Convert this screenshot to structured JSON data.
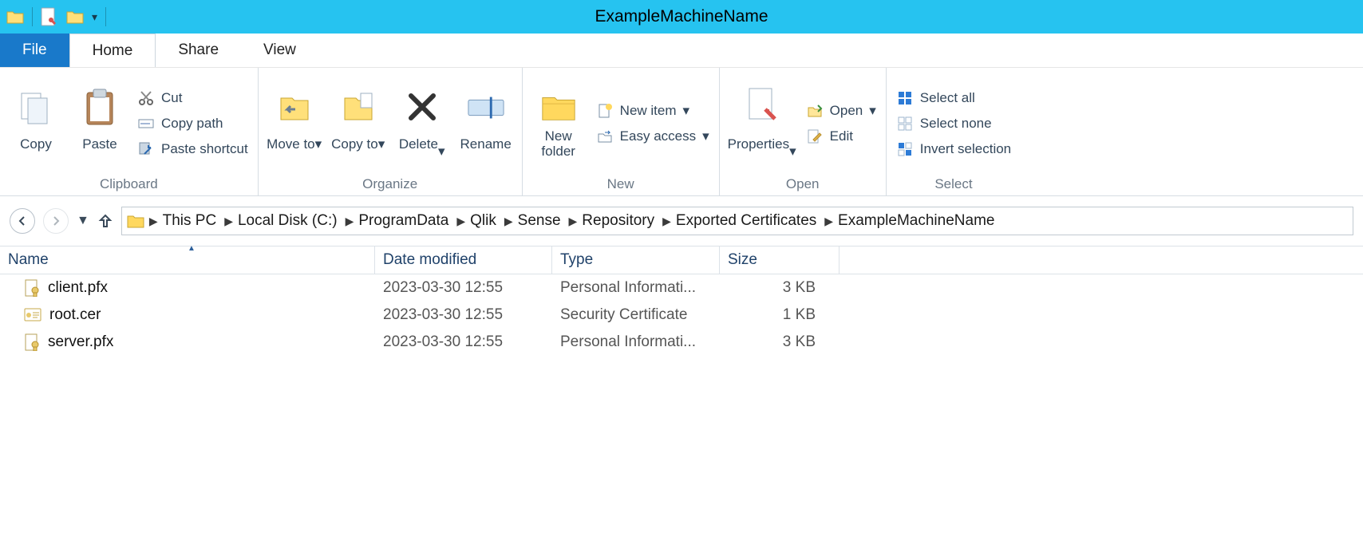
{
  "window": {
    "title": "ExampleMachineName"
  },
  "menubar": {
    "file": "File",
    "home": "Home",
    "share": "Share",
    "view": "View"
  },
  "ribbon": {
    "clipboard": {
      "label": "Clipboard",
      "copy": "Copy",
      "paste": "Paste",
      "cut": "Cut",
      "copy_path": "Copy path",
      "paste_shortcut": "Paste shortcut"
    },
    "organize": {
      "label": "Organize",
      "move_to": "Move to",
      "copy_to": "Copy to",
      "delete": "Delete",
      "rename": "Rename"
    },
    "new": {
      "label": "New",
      "new_folder": "New folder",
      "new_item": "New item",
      "easy_access": "Easy access"
    },
    "open": {
      "label": "Open",
      "properties": "Properties",
      "open": "Open",
      "edit": "Edit"
    },
    "select": {
      "label": "Select",
      "select_all": "Select all",
      "select_none": "Select none",
      "invert": "Invert selection"
    }
  },
  "breadcrumb": {
    "items": [
      "This PC",
      "Local Disk (C:)",
      "ProgramData",
      "Qlik",
      "Sense",
      "Repository",
      "Exported Certificates",
      "ExampleMachineName"
    ]
  },
  "columns": {
    "name": "Name",
    "date": "Date modified",
    "type": "Type",
    "size": "Size"
  },
  "files": [
    {
      "name": "client.pfx",
      "date": "2023-03-30 12:55",
      "type": "Personal Informati...",
      "size": "3 KB",
      "icon": "pfx"
    },
    {
      "name": "root.cer",
      "date": "2023-03-30 12:55",
      "type": "Security Certificate",
      "size": "1 KB",
      "icon": "cer"
    },
    {
      "name": "server.pfx",
      "date": "2023-03-30 12:55",
      "type": "Personal Informati...",
      "size": "3 KB",
      "icon": "pfx"
    }
  ]
}
